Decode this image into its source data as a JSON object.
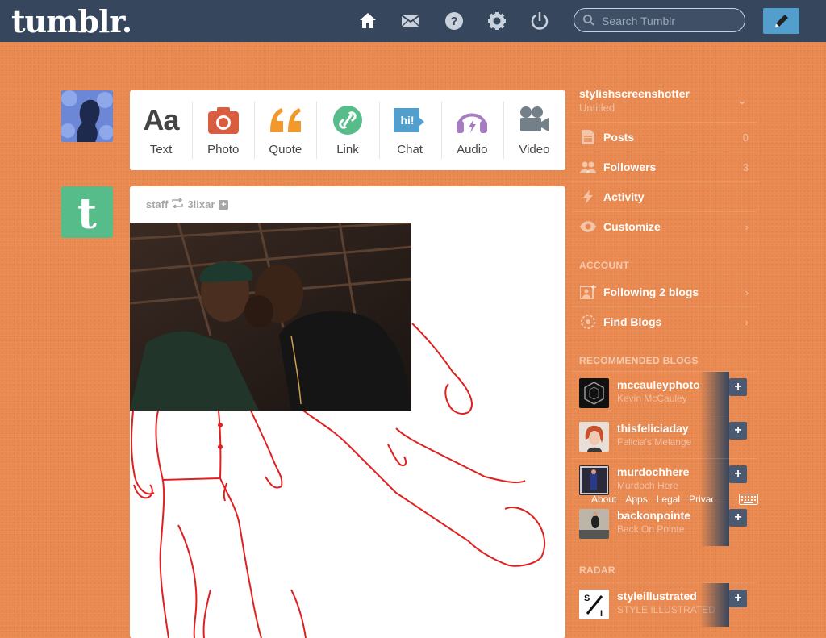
{
  "header": {
    "logo": "tumblr.",
    "nav_icons": [
      "home-icon",
      "mail-icon",
      "help-icon",
      "gear-icon",
      "power-icon"
    ],
    "search_placeholder": "Search Tumblr",
    "compose_icon": "pencil-icon"
  },
  "post_types": [
    {
      "label": "Text",
      "icon": "text-icon",
      "color": "#444444"
    },
    {
      "label": "Photo",
      "icon": "camera-icon",
      "color": "#d95e40"
    },
    {
      "label": "Quote",
      "icon": "quote-icon",
      "color": "#f2992e"
    },
    {
      "label": "Link",
      "icon": "link-icon",
      "color": "#56bc8a"
    },
    {
      "label": "Chat",
      "icon": "chat-icon",
      "color": "#529ecc"
    },
    {
      "label": "Audio",
      "icon": "headphones-icon",
      "color": "#a77dc2"
    },
    {
      "label": "Video",
      "icon": "video-camera-icon",
      "color": "#748089"
    }
  ],
  "post": {
    "author": "staff",
    "reblogged_from": "3lixar"
  },
  "sidebar": {
    "blog_name": "stylishscreenshotter",
    "blog_title": "Untitled",
    "menu": [
      {
        "label": "Posts",
        "count": "0",
        "icon": "posts-icon"
      },
      {
        "label": "Followers",
        "count": "3",
        "icon": "followers-icon"
      },
      {
        "label": "Activity",
        "count": "",
        "icon": "lightning-icon"
      },
      {
        "label": "Customize",
        "count": "›",
        "icon": "eye-icon"
      }
    ],
    "account_heading": "ACCOUNT",
    "account": [
      {
        "label": "Following 2 blogs",
        "icon": "following-icon"
      },
      {
        "label": "Find Blogs",
        "icon": "compass-icon"
      }
    ],
    "recommended_heading": "RECOMMENDED BLOGS",
    "recommended": [
      {
        "name": "mccauleyphoto",
        "title": "Kevin McCauley"
      },
      {
        "name": "thisfeliciaday",
        "title": "Felicia's Melange"
      },
      {
        "name": "murdochhere",
        "title": "Murdoch Here"
      },
      {
        "name": "backonpointe",
        "title": "Back On Pointe"
      }
    ],
    "radar_heading": "RADAR",
    "radar": {
      "name": "styleillustrated",
      "title": "STYLE ILLUSTRATED"
    }
  },
  "footer_links": [
    "About",
    "Apps",
    "Legal",
    "Privacy"
  ],
  "colors": {
    "header_bg": "#36465d",
    "page_bg": "#e9884f",
    "accent": "#529ecc"
  }
}
